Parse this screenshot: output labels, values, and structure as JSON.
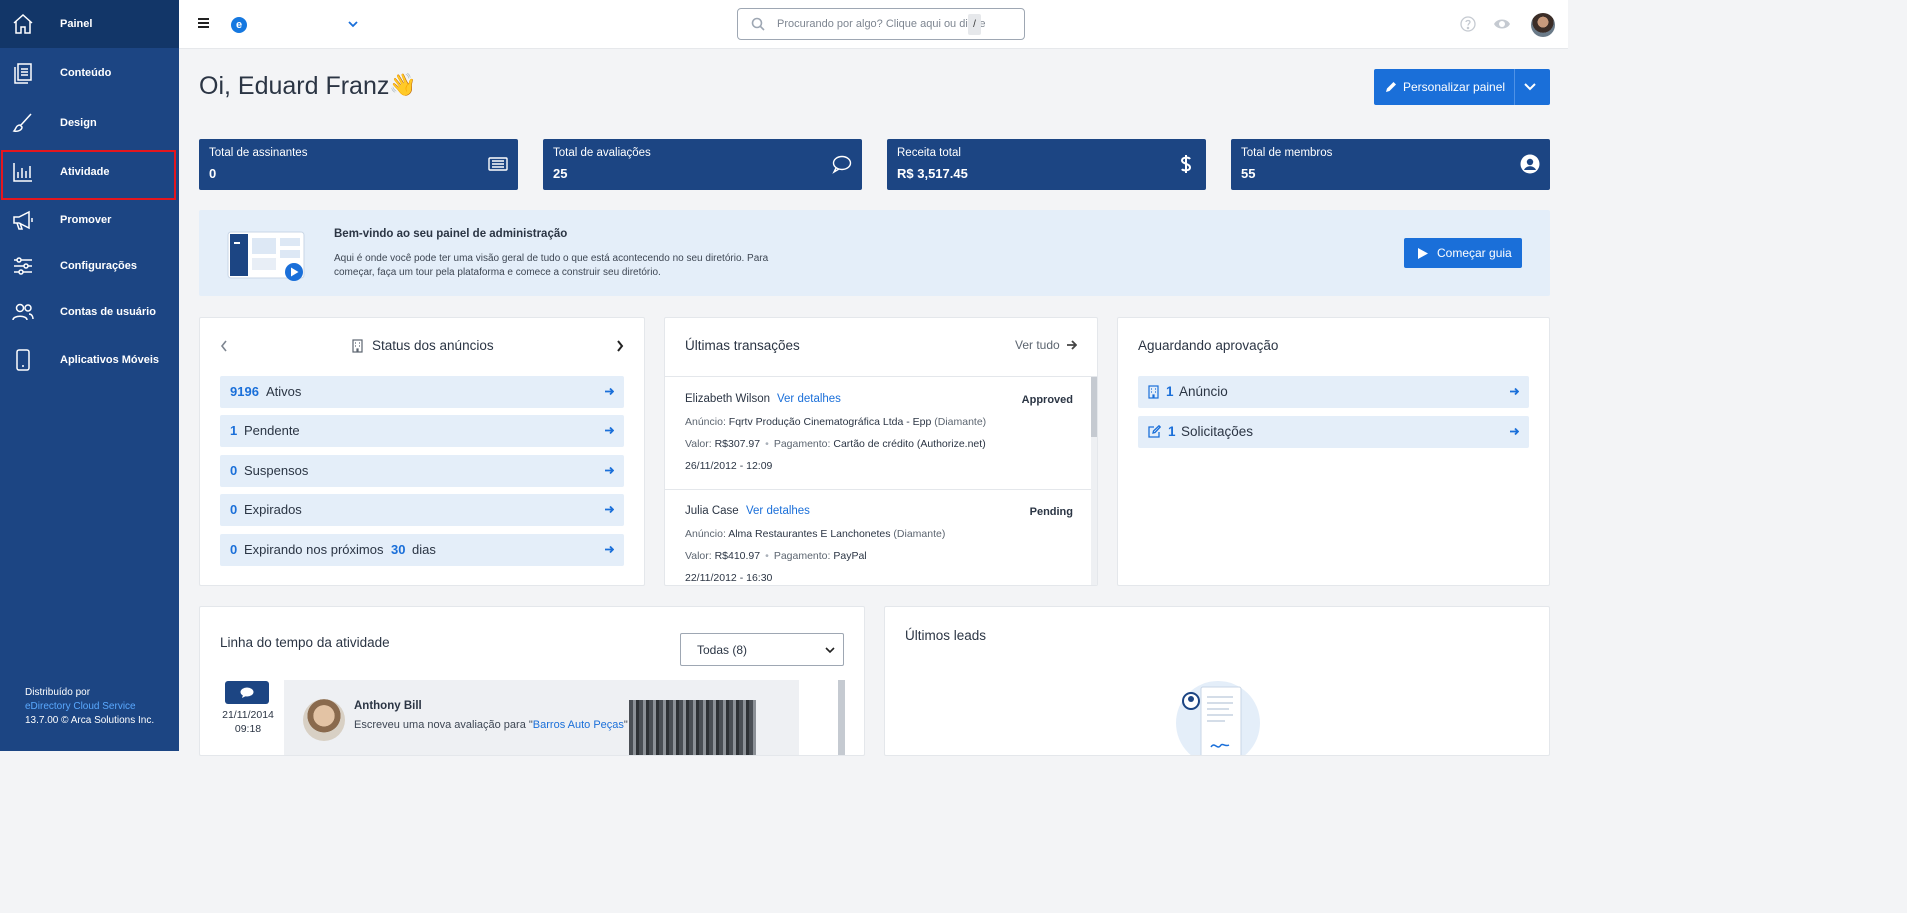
{
  "sidebar": {
    "items": [
      {
        "label": "Painel",
        "icon": "home-icon"
      },
      {
        "label": "Conteúdo",
        "icon": "content-icon"
      },
      {
        "label": "Design",
        "icon": "brush-icon"
      },
      {
        "label": "Atividade",
        "icon": "bar-chart-icon"
      },
      {
        "label": "Promover",
        "icon": "megaphone-icon"
      },
      {
        "label": "Configurações",
        "icon": "sliders-icon"
      },
      {
        "label": "Contas de usuário",
        "icon": "users-icon"
      },
      {
        "label": "Aplicativos Móveis",
        "icon": "mobile-icon"
      }
    ],
    "footer": {
      "line1": "Distribuído por",
      "link": "eDirectory Cloud Service",
      "line3": "13.7.00 © Arca Solutions Inc."
    }
  },
  "topbar": {
    "brand_letter": "e",
    "search_placeholder": "Procurando por algo? Clique aqui ou digite",
    "search_shortcut": "/"
  },
  "main": {
    "greeting": "Oi, Eduard Franz",
    "wave": "👋",
    "customize_button": "Personalizar painel"
  },
  "stats": [
    {
      "title": "Total de assinantes",
      "value": "0",
      "icon": "newspaper-icon"
    },
    {
      "title": "Total de avaliações",
      "value": "25",
      "icon": "comment-icon"
    },
    {
      "title": "Receita total",
      "value": "R$ 3,517.45",
      "icon": "dollar-icon"
    },
    {
      "title": "Total de membros",
      "value": "55",
      "icon": "user-circle-icon"
    }
  ],
  "welcome": {
    "title": "Bem-vindo ao seu painel de administração",
    "description": "Aqui é onde você pode ter uma visão geral de tudo o que está acontecendo no seu diretório. Para começar, faça um tour pela plataforma e comece a construir seu diretório.",
    "button": "Começar guia"
  },
  "listing_status": {
    "title": "Status dos anúncios",
    "rows": [
      {
        "count": "9196",
        "label": "Ativos"
      },
      {
        "count": "1",
        "label": "Pendente"
      },
      {
        "count": "0",
        "label": "Suspensos"
      },
      {
        "count": "0",
        "label": "Expirados"
      },
      {
        "count": "0",
        "label": "Expirando nos próximos",
        "days": "30",
        "suffix": "dias"
      }
    ]
  },
  "transactions": {
    "title": "Últimas transações",
    "view_all": "Ver tudo",
    "items": [
      {
        "name": "Elizabeth Wilson",
        "details": "Ver detalhes",
        "status": "Approved",
        "listing_label": "Anúncio:",
        "listing": "Fqrtv Produção Cinematográfica Ltda - Epp",
        "level": "(Diamante)",
        "value_label": "Valor:",
        "value": "R$307.97",
        "payment_label": "Pagamento:",
        "payment": "Cartão de crédito (Authorize.net)",
        "date": "26/11/2012 - 12:09"
      },
      {
        "name": "Julia Case",
        "details": "Ver detalhes",
        "status": "Pending",
        "listing_label": "Anúncio:",
        "listing": "Alma Restaurantes E Lanchonetes",
        "level": "(Diamante)",
        "value_label": "Valor:",
        "value": "R$410.97",
        "payment_label": "Pagamento:",
        "payment": "PayPal",
        "date": "22/11/2012 - 16:30"
      }
    ]
  },
  "approval": {
    "title": "Aguardando aprovação",
    "rows": [
      {
        "count": "1",
        "label": "Anúncio",
        "icon": "building-icon"
      },
      {
        "count": "1",
        "label": "Solicitações",
        "icon": "edit-icon"
      }
    ]
  },
  "timeline": {
    "title": "Linha do tempo da atividade",
    "filter": "Todas (8)",
    "entry": {
      "date": "21/11/2014",
      "time": "09:18",
      "user": "Anthony Bill",
      "text_prefix": "Escreveu uma nova avaliação para \"",
      "link": "Barros Auto Peças",
      "text_suffix": "\""
    }
  },
  "leads": {
    "title": "Últimos leads"
  },
  "colors": {
    "sidebar": "#1c4583",
    "accent": "#1a6fd9",
    "highlight": "#e3161e"
  }
}
